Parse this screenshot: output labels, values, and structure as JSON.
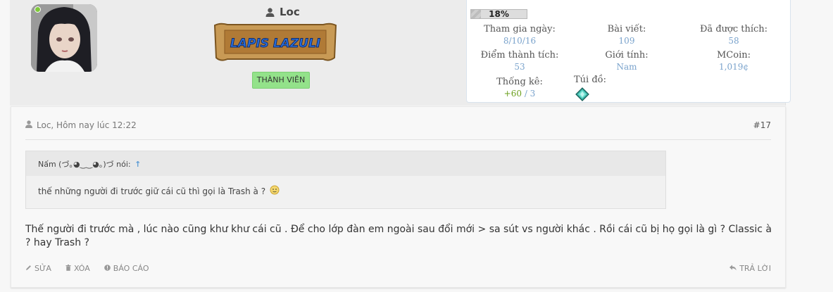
{
  "user": {
    "name": "Loc",
    "banner_text": "LAPIS LAZULI",
    "role": "THÀNH VIÊN"
  },
  "stats": {
    "progress": {
      "label": "18%",
      "value": 0.18
    },
    "join_label": "Tham gia ngày:",
    "join_value": "8/10/16",
    "posts_label": "Bài viết:",
    "posts_value": "109",
    "likes_label": "Đã được thích:",
    "likes_value": "58",
    "points_label": "Điểm thành tích:",
    "points_value": "53",
    "gender_label": "Giới tính:",
    "gender_value": "Nam",
    "mcoin_label": "MCoin:",
    "mcoin_value": "1,019¢",
    "stat_label": "Thống kê:",
    "stat_positive": "+60",
    "stat_sep": " / ",
    "stat_total": "3",
    "bag_label": "Túi đồ:"
  },
  "post": {
    "meta": "Loc, Hôm nay lúc 12:22",
    "number": "#17",
    "quote_author": "Nấm (づ｡◕‿‿◕｡)づ nói:",
    "quote_arrow": "↑",
    "quote_text": "thế những người đi trước giữ cái cũ thì gọi là Trash à ?",
    "body": "Thế người đi trước mà , lúc nào cũng khư khư cái cũ . Để cho lớp đàn em ngoài sau đổi mới > sa sút vs người khác . Rồi cái cũ bị họ gọi là gì ? Classic à ? hay Trash ?",
    "actions": {
      "edit": "SỬA",
      "delete": "XÓA",
      "report": "BÁO CÁO",
      "reply": "TRẢ LỜI"
    }
  },
  "colors": {
    "online": "#7ec83a",
    "badge": "#93e28a",
    "link": "#7aa3cc",
    "positive": "#6a9f1c"
  }
}
